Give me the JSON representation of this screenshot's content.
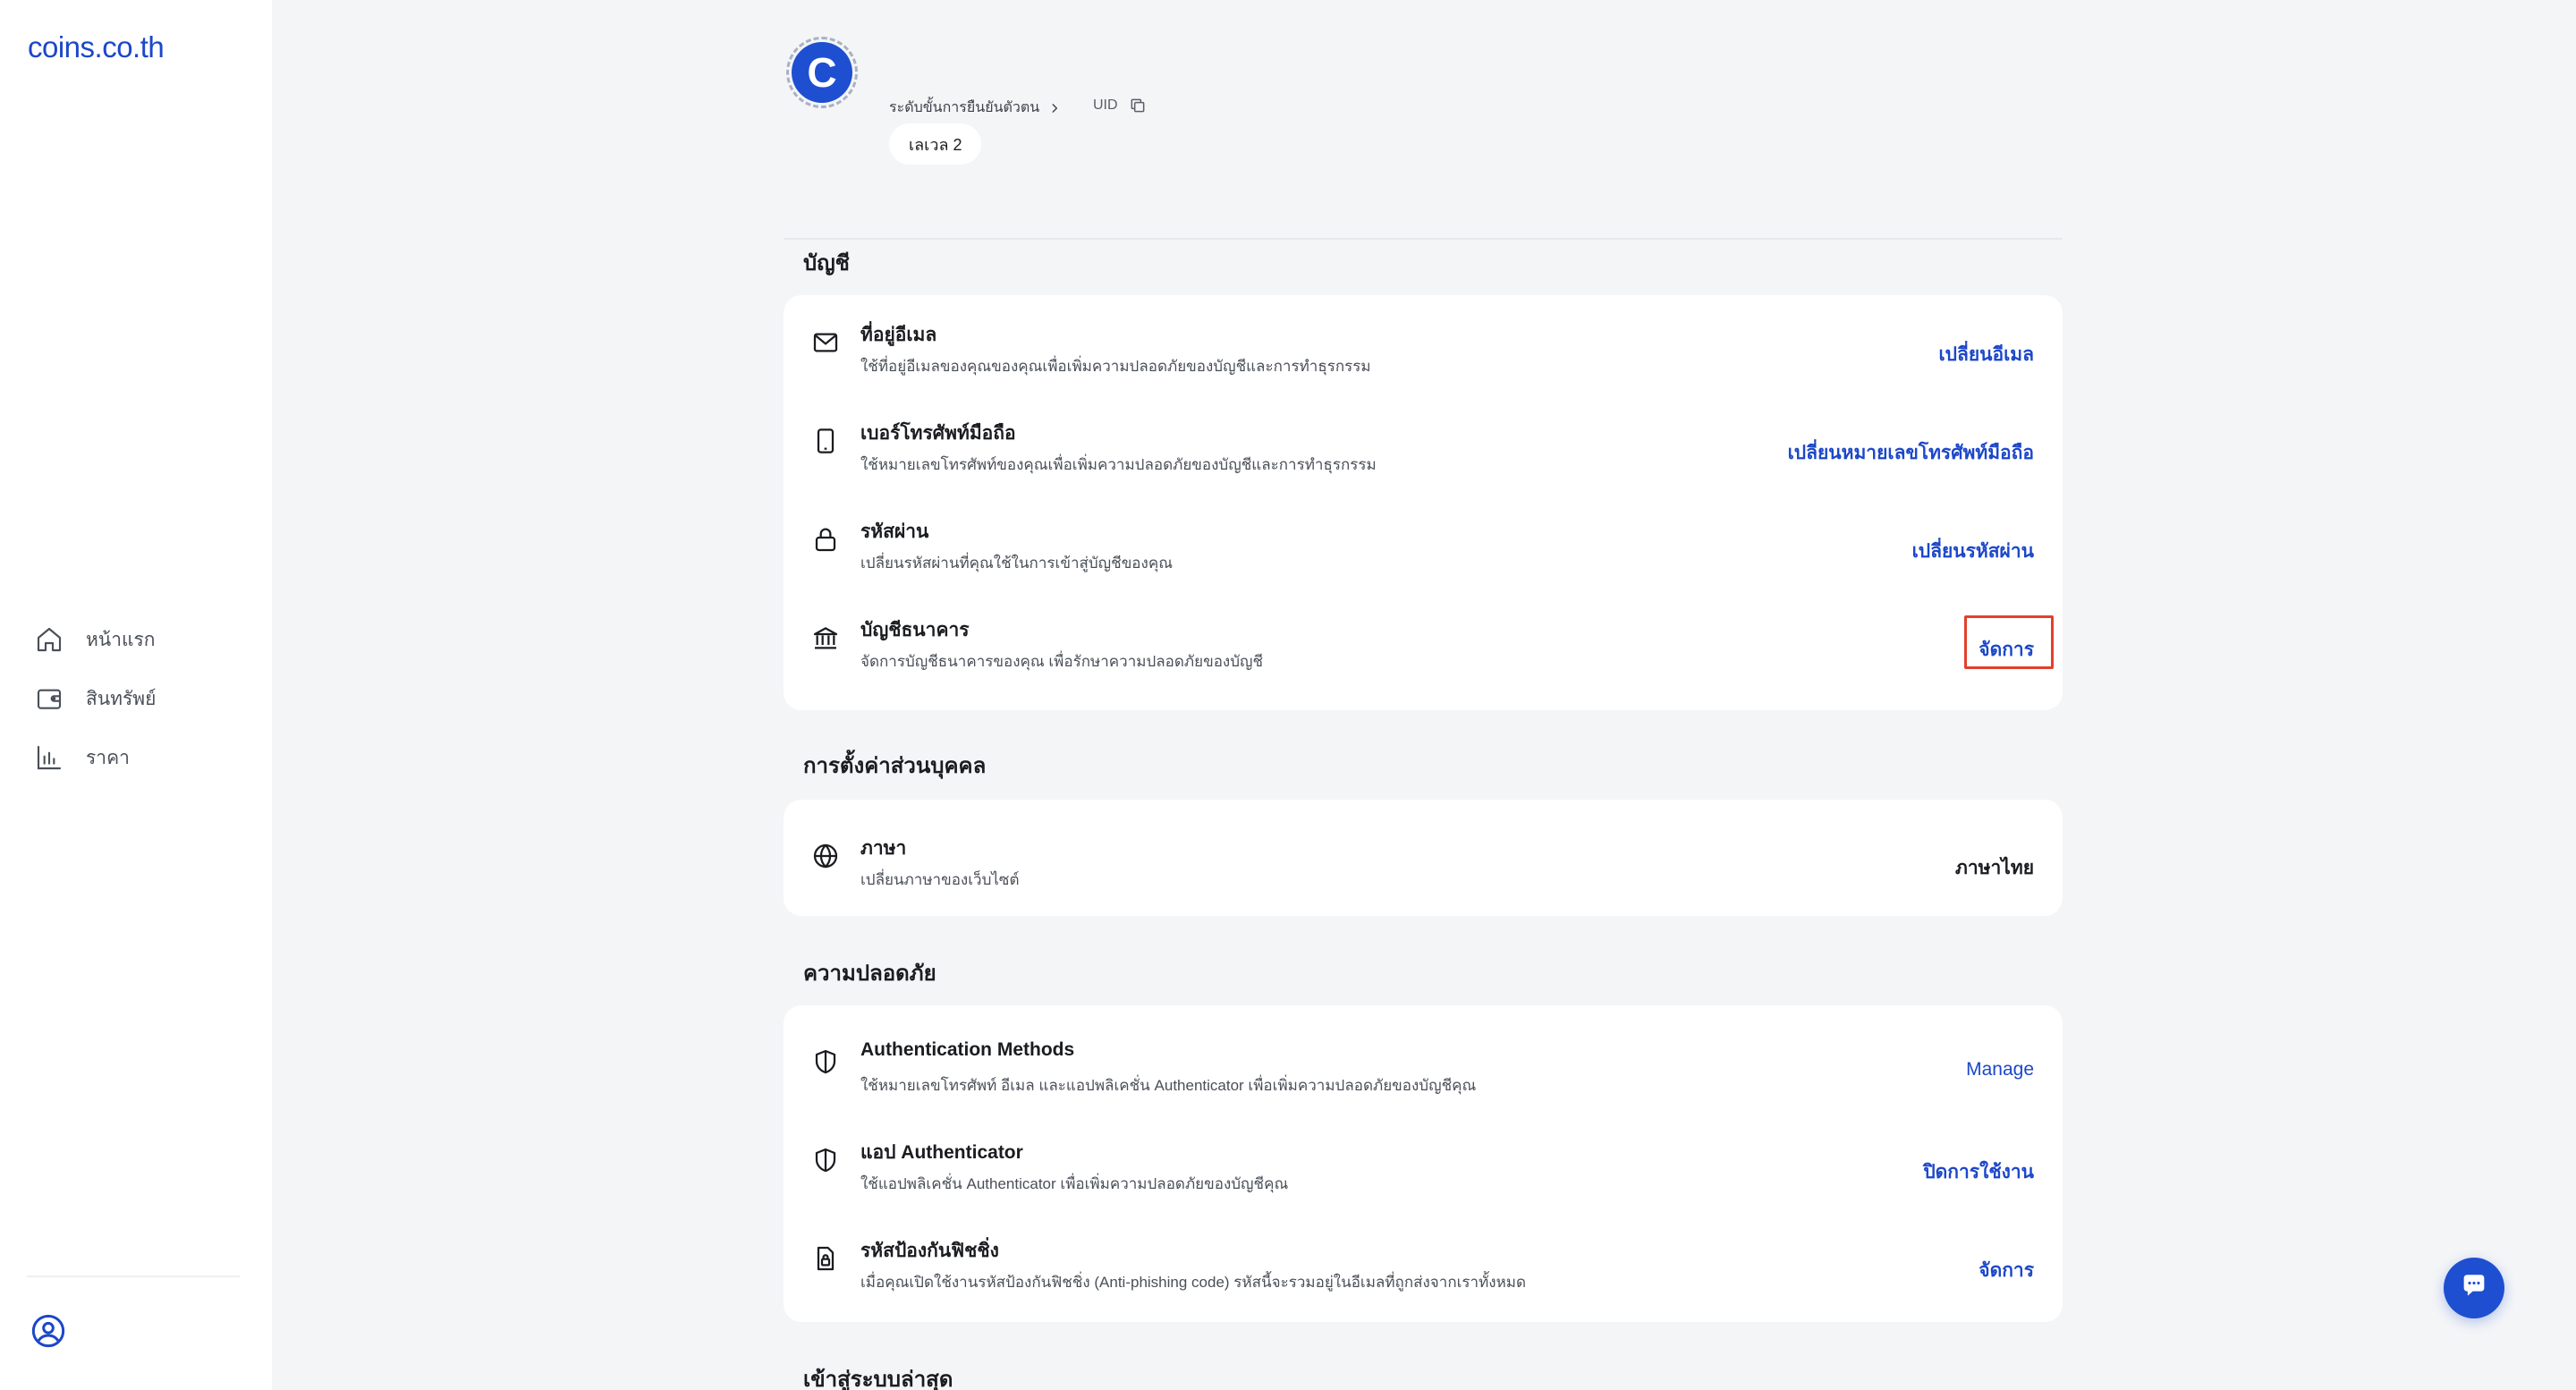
{
  "brand": {
    "logo": "coins.co.th",
    "accent": "#1c47c9",
    "highlight": "#e2402c"
  },
  "sidebar": {
    "items": [
      {
        "label": "หน้าแรก",
        "icon": "home-icon"
      },
      {
        "label": "สินทรัพย์",
        "icon": "wallet-icon"
      },
      {
        "label": "ราคา",
        "icon": "chart-icon"
      }
    ],
    "profile_icon": "user-circle-icon"
  },
  "header": {
    "avatar_letter": "C",
    "kyc_label": "ระดับขั้นการยืนยันตัวตน",
    "uid_label": "UID",
    "level": "เลเวล 2"
  },
  "account": {
    "title": "บัญชี",
    "rows": [
      {
        "icon": "mail-icon",
        "title": "ที่อยู่อีเมล",
        "desc": "ใช้ที่อยู่อีเมลของคุณของคุณเพื่อเพิ่มความปลอดภัยของบัญชีและการทำธุรกรรม",
        "action": "เปลี่ยนอีเมล"
      },
      {
        "icon": "phone-icon",
        "title": "เบอร์โทรศัพท์มือถือ",
        "desc": "ใช้หมายเลขโทรศัพท์ของคุณเพื่อเพิ่มความปลอดภัยของบัญชีและการทำธุรกรรม",
        "action": "เปลี่ยนหมายเลขโทรศัพท์มือถือ"
      },
      {
        "icon": "lock-icon",
        "title": "รหัสผ่าน",
        "desc": "เปลี่ยนรหัสผ่านที่คุณใช้ในการเข้าสู่บัญชีของคุณ",
        "action": "เปลี่ยนรหัสผ่าน"
      },
      {
        "icon": "bank-icon",
        "title": "บัญชีธนาคาร",
        "desc": "จัดการบัญชีธนาคารของคุณ เพื่อรักษาความปลอดภัยของบัญชี",
        "action": "จัดการ"
      }
    ]
  },
  "personal": {
    "title": "การตั้งค่าส่วนบุคคล",
    "rows": [
      {
        "icon": "globe-icon",
        "title": "ภาษา",
        "desc": "เปลี่ยนภาษาของเว็บไซต์",
        "value": "ภาษาไทย"
      }
    ]
  },
  "security": {
    "title": "ความปลอดภัย",
    "rows": [
      {
        "icon": "shield-icon",
        "title": "Authentication Methods",
        "desc": "ใช้หมายเลขโทรศัพท์ อีเมล และแอปพลิเคชั่น Authenticator เพื่อเพิ่มความปลอดภัยของบัญชีคุณ",
        "action": "Manage"
      },
      {
        "icon": "shield-icon",
        "title": "แอป Authenticator",
        "desc": "ใช้แอปพลิเคชั่น Authenticator เพื่อเพิ่มความปลอดภัยของบัญชีคุณ",
        "action": "ปิดการใช้งาน"
      },
      {
        "icon": "phishing-lock-icon",
        "title": "รหัสป้องกันฟิชชิ่ง",
        "desc": "เมื่อคุณเปิดใช้งานรหัสป้องกันฟิชชิ่ง (Anti-phishing code) รหัสนี้จะรวมอยู่ในอีเมลที่ถูกส่งจากเราทั้งหมด",
        "action": "จัดการ"
      }
    ]
  },
  "recent_login": {
    "title": "เข้าสู่ระบบล่าสุด"
  },
  "chat": {
    "icon": "chat-icon"
  }
}
